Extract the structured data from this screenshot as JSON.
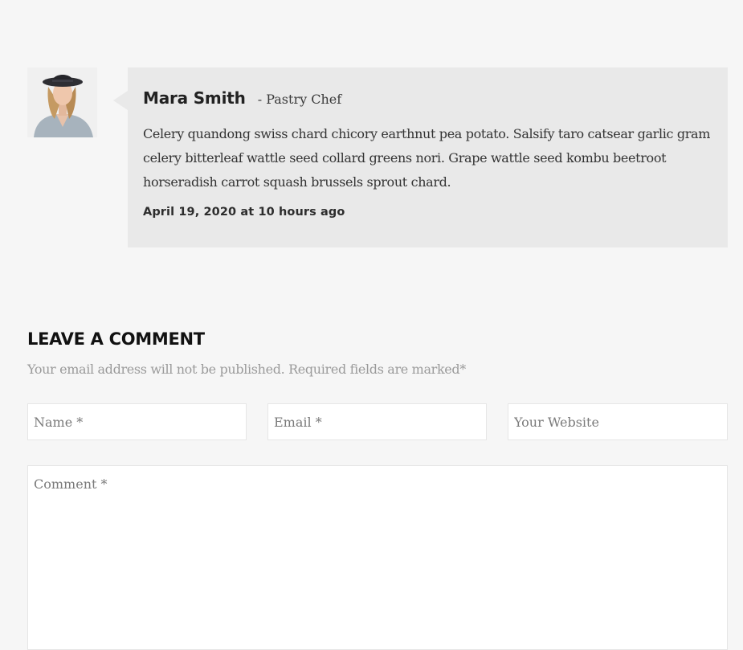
{
  "comment": {
    "author_name": "Mara Smith",
    "author_role": "- Pastry Chef",
    "text": "Celery quandong swiss chard chicory earthnut pea potato. Salsify taro catsear garlic gram celery bitterleaf wattle seed collard greens nori. Grape wattle seed kombu beetroot horseradish carrot squash brussels sprout chard.",
    "date": "April 19, 2020 at 10 hours ago"
  },
  "form": {
    "title": "LEAVE A COMMENT",
    "note": "Your email address will not be published. Required fields are marked*",
    "name_placeholder": "Name *",
    "email_placeholder": "Email *",
    "website_placeholder": "Your Website",
    "comment_placeholder": "Comment *"
  },
  "colors": {
    "page_background": "#f6f6f6",
    "bubble_background": "#e9e9e9",
    "heading": "#111111",
    "muted_text": "#9a9a9a"
  }
}
